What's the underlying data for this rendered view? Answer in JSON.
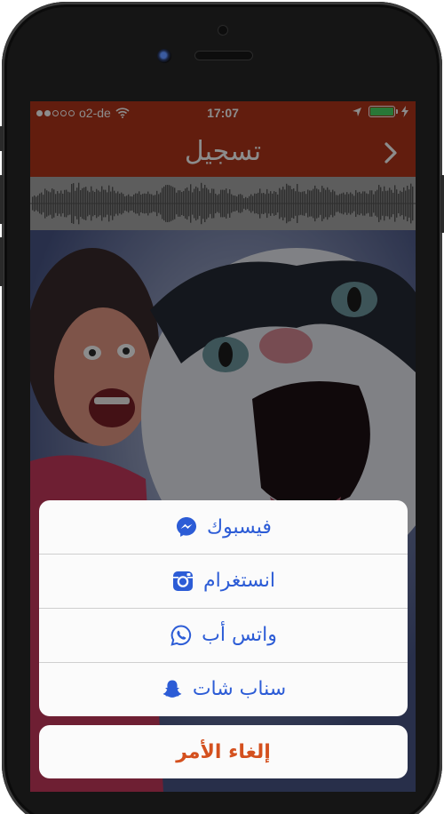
{
  "status_bar": {
    "carrier": "o2-de",
    "time": "17:07",
    "signal_dots_filled": 2,
    "signal_dots_total": 5,
    "battery_level": 1.0,
    "battery_color": "#4cd964"
  },
  "navbar": {
    "title": "تسجيل",
    "back_icon": "chevron-right-icon",
    "color": "#b3361a"
  },
  "waveform": {
    "color": "#555555",
    "background": "#a9a9a9"
  },
  "share_sheet": {
    "items": [
      {
        "label": "فيسبوك",
        "icon": "messenger-icon"
      },
      {
        "label": "انستغرام",
        "icon": "instagram-icon"
      },
      {
        "label": "واتس أب",
        "icon": "whatsapp-icon"
      },
      {
        "label": "سناب شات",
        "icon": "snapchat-icon"
      }
    ],
    "text_color": "#2c5cd6"
  },
  "cancel": {
    "label": "إلغاء الأمر",
    "color": "#d4501e"
  }
}
